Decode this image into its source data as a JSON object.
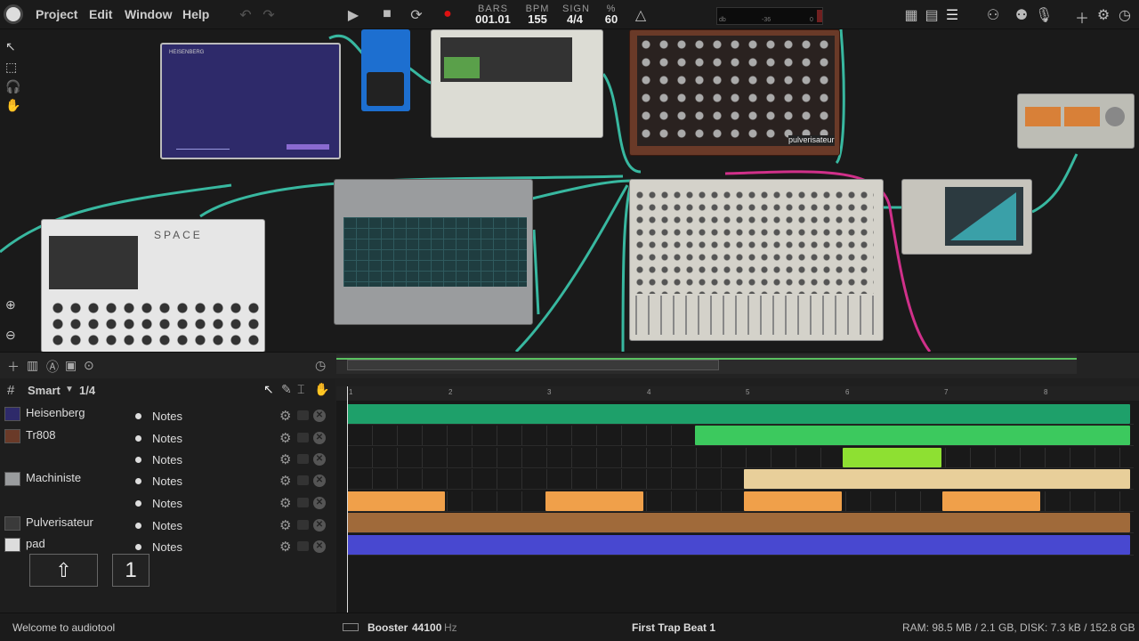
{
  "menu": {
    "project": "Project",
    "edit": "Edit",
    "window": "Window",
    "help": "Help"
  },
  "transport": {
    "bars_label": "BARS",
    "bars_value": "001.01",
    "bpm_label": "BPM",
    "bpm_value": "155",
    "sign_label": "SIGN",
    "sign_value": "4/4",
    "pct_label": "%",
    "pct_value": "60"
  },
  "meter": {
    "db": "db",
    "l": "-36",
    "r": "0"
  },
  "devices": {
    "heisenberg": "HEISENBERG",
    "space": "SPACE",
    "pulverisateur": "pulverisateur"
  },
  "arrange": {
    "tool_mode": "Smart",
    "snap": "1/4",
    "ruler": [
      "1",
      "2",
      "3",
      "4",
      "5",
      "6",
      "7",
      "8"
    ]
  },
  "tracks": [
    {
      "name": "Heisenberg",
      "notes": "Notes"
    },
    {
      "name": "Tr808",
      "notes": "Notes"
    },
    {
      "name": "",
      "notes": "Notes"
    },
    {
      "name": "Machiniste",
      "notes": "Notes"
    },
    {
      "name": "",
      "notes": "Notes"
    },
    {
      "name": "Pulverisateur",
      "notes": "Notes"
    },
    {
      "name": "pad",
      "notes": "Notes"
    }
  ],
  "keys": {
    "shift": "⇧",
    "one": "1"
  },
  "status": {
    "welcome": "Welcome to audiotool",
    "device": "Booster",
    "rate": "44100",
    "rate_unit": "Hz",
    "project": "First Trap Beat 1",
    "stats": "RAM: 98.5 MB / 2.1 GB, DISK: 7.3 kB / 152.8 GB"
  },
  "colors": {
    "green_dark": "#1ea06a",
    "green": "#3cc95e",
    "lime": "#8ee032",
    "sand": "#e8cf9a",
    "orange": "#f0a04a",
    "brown": "#a06a3a",
    "blue": "#4848d0",
    "cable": "#38b8a0",
    "cable_pink": "#d0308a"
  }
}
